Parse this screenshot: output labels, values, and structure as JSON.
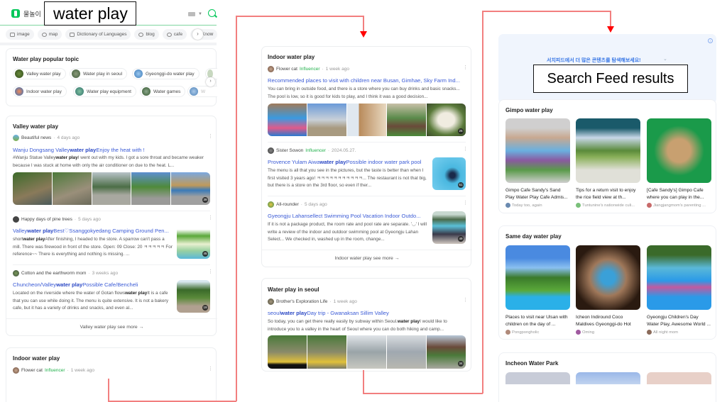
{
  "search": {
    "service_label": "물놀이",
    "query": "water play"
  },
  "tabs": [
    {
      "label": "image",
      "icon": "image-icon"
    },
    {
      "label": "map",
      "icon": "map-pin-icon"
    },
    {
      "label": "Dictionary of Languages",
      "icon": "dictionary-icon"
    },
    {
      "label": "blog",
      "icon": "blog-icon"
    },
    {
      "label": "cafe",
      "icon": "cafe-icon"
    },
    {
      "label": "Know",
      "icon": "knowledge-icon"
    }
  ],
  "popular": {
    "title": "Water play popular topic",
    "row1": [
      "Valley water play",
      "Water play in seoul",
      "Gyeonggi-do water play"
    ],
    "row2": [
      "Indoor water play",
      "Water play equipment",
      "Water games",
      "W"
    ]
  },
  "valley": {
    "title": "Valley water play",
    "posts": [
      {
        "author": "Beautiful news",
        "time": "4 days ago",
        "title_pre": "Wanju Dongsang Valley",
        "title_bold": "water play",
        "title_post": "Enjoy the heat with !",
        "body_pre": "#Wanju Statue Valley",
        "body_bold": "water play",
        "body_post": "I went out with my kids. I got a sore throat and became weaker because I was stuck at home with only the air conditioner on due to the heat. L...",
        "count": "39"
      },
      {
        "author": "Happy days of pine trees",
        "time": "5 days ago",
        "title_pre": "Valley",
        "title_bold": "water play",
        "title_post": "Best♡Ssanggokyedang Camping Ground Pen...",
        "body_pre": "short",
        "body_bold": "water play",
        "body_post": "After finishing, I headed to the store. A sparrow can't pass a mill. There was firewood in front of the store. Open: 09 Close: 20 ㅋㅋㅋㅋㅋ For reference~~ There is everything and nothing is missing. ...",
        "count": "45"
      },
      {
        "author": "Cotton and the earthworm mom",
        "time": "3 weeks ago",
        "title_pre": "Chuncheon/Valley",
        "title_bold": "water play",
        "title_post": "Possible Cafe/Bencheli",
        "body_pre": "Located on the riverside where the water of Gotan flows",
        "body_bold": "water play",
        "body_post": "It is a cafe that you can use while doing it. The menu is quite extensive. It is not a bakery cafe, but it has a variety of drinks and snacks, and even al...",
        "count": "19"
      }
    ],
    "see_more": "Valley water play see more →"
  },
  "indoor_left": {
    "title": "Indoor water play",
    "author": "Flower cat",
    "badge": "Influencer",
    "time": "1 week ago"
  },
  "indoor": {
    "title": "Indoor water play",
    "posts": [
      {
        "author": "Flower cat",
        "badge": "Influencer",
        "time": "1 week ago",
        "title": "Recommended places to visit with children near Busan, Gimhae, Sky Farm Ind...",
        "body": "You can bring in outside food, and there is a store where you can buy drinks and basic snacks... The pool is low, so it is good for kids to play, and I think it was a good decision...",
        "count": "26"
      },
      {
        "author": "Sister Sowon",
        "badge": "Influencer",
        "time": "2024.05.27.",
        "title_pre": "Provence Yulam Aiwa",
        "title_bold": "water play",
        "title_post": "Possible indoor water park pool",
        "body": "The menu is all that you see in the pictures, but the taste is better than when I first visited 3 years ago! ㅋㅋㅋㅋㅋㅋㅋㅋㅋㅋㅋ... The restaurant is not that big, but there is a store on the 3rd floor, so even if ther...",
        "count": "51"
      },
      {
        "author": "All-rounder",
        "time": "5 days ago",
        "title": "Gyeongju Lahansellect Swimming Pool Vacation Indoor Outdo...",
        "body": "If it is not a package product, the room rate and pool rate are separate. '◡' I will write a review of the indoor and outdoor swimming pool at Gyeongju Lahan Select... We checked in, washed up in the room, change...",
        "count": "49"
      }
    ],
    "see_more": "Indoor water play see more →"
  },
  "seoul": {
    "title": "Water play in seoul",
    "author": "Brother's Exploration Life",
    "time": "1 week ago",
    "title_pre": "seoul",
    "title_bold": "water play",
    "title_post": "Day trip - Gwanaksan Sillim Valley",
    "body_pre": "So today, you can get there really easily by subway within Seoul.",
    "body_bold": "water play",
    "body_post": "I would like to introduce you to a valley in the heart of Seoul where you can do both hiking and camp...",
    "count": "34"
  },
  "feed": {
    "cta": "서치피드에서 더 많은 콘텐츠를 탐색해보세요!",
    "label": "Search Feed results",
    "sections": [
      {
        "title": "Gimpo water play",
        "items": [
          {
            "caption": "Gimpo Cafe Sandy's Sand Play Water Play Cafe Admis...",
            "source": "Today too, again"
          },
          {
            "caption": "Tips for a return visit to enjoy the rice field view at th...",
            "source": "Tuntunine's nationwide culi..."
          },
          {
            "caption": "[Cafe Sandy's] Gimpo Cafe where you can play in the...",
            "source": "Jiangjangmom's parenting ..."
          }
        ]
      },
      {
        "title": "Same day water play",
        "items": [
          {
            "caption": "Places to visit near Ulsan with children on the day of ...",
            "source": "Pongpongholic"
          },
          {
            "caption": "Icheon Indiround Coco Maldives Gyeonggi-do Hot Sp...",
            "source": "Oming"
          },
          {
            "caption": "Gyeongju Children's Day Water Play, Awesome World ...",
            "source": "All night mom"
          }
        ]
      },
      {
        "title": "Incheon Water Park",
        "items": []
      }
    ]
  },
  "colors": {
    "brand_green": "#03c75a",
    "link_blue": "#3b5bd6",
    "influencer_green": "#22b14c",
    "connector_red": "#f27f7f",
    "arrow_red": "#ff0000",
    "feed_bg": "#f0f5fd"
  }
}
